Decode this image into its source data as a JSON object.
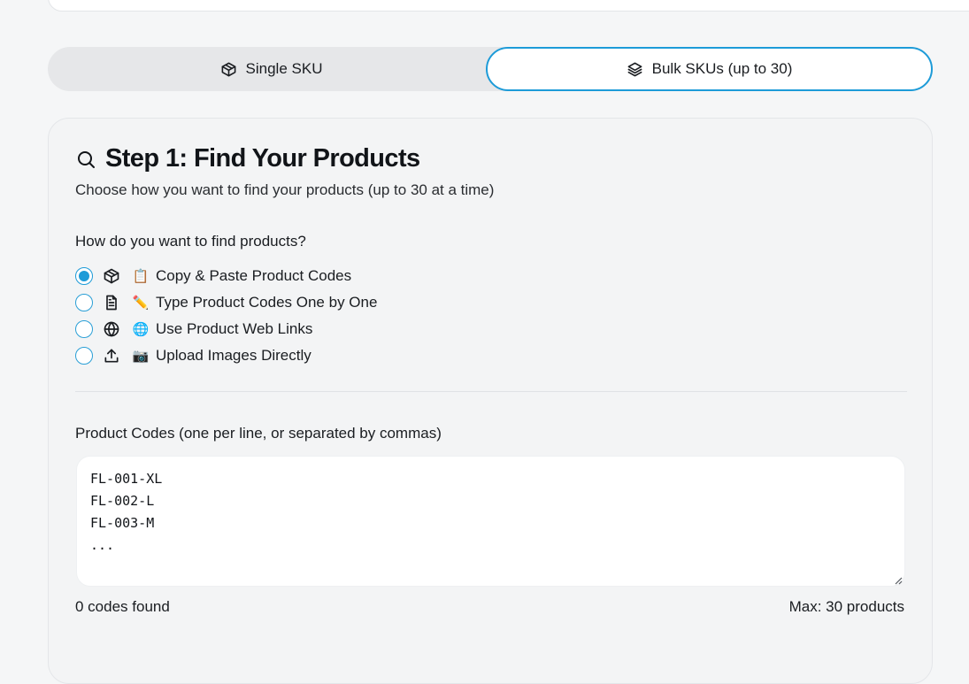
{
  "mode_toggle": {
    "single_label": "Single SKU",
    "bulk_label": "Bulk SKUs (up to 30)",
    "active": "bulk"
  },
  "step": {
    "title": "Step 1: Find Your Products",
    "subtitle": "Choose how you want to find your products (up to 30 at a time)"
  },
  "method": {
    "question": "How do you want to find products?",
    "options": [
      {
        "icon": "box-icon",
        "emoji": "📋",
        "label": "Copy & Paste Product Codes",
        "checked": true
      },
      {
        "icon": "file-text-icon",
        "emoji": "✏️",
        "label": "Type Product Codes One by One",
        "checked": false
      },
      {
        "icon": "globe-icon",
        "emoji": "🌐",
        "label": "Use Product Web Links",
        "checked": false
      },
      {
        "icon": "upload-icon",
        "emoji": "📷",
        "label": "Upload Images Directly",
        "checked": false
      }
    ]
  },
  "codes": {
    "label": "Product Codes (one per line, or separated by commas)",
    "placeholder": "FL-001-XL\nFL-002-L\nFL-003-M\n...",
    "count_text": "0 codes found",
    "max_text": "Max: 30 products"
  },
  "colors": {
    "accent": "#1d9bd8",
    "panel_bg": "#f3f4f5",
    "page_bg": "#f5f6f7"
  }
}
